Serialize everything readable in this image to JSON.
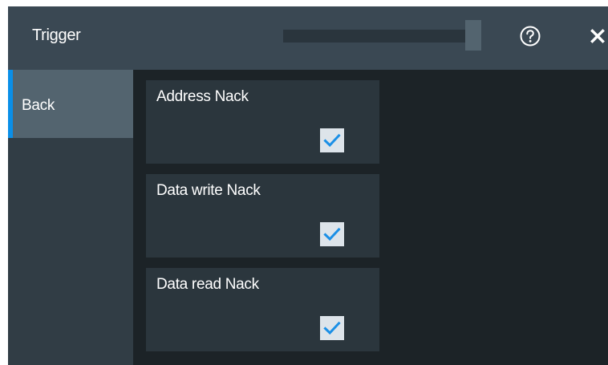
{
  "dialog": {
    "title": "Trigger",
    "help_icon": "help-circle-icon",
    "close_icon": "close-icon"
  },
  "sidebar": {
    "back_label": "Back",
    "accent_color": "#0a8fe8"
  },
  "options": [
    {
      "label": "Address Nack",
      "checked": true
    },
    {
      "label": "Data write Nack",
      "checked": true
    },
    {
      "label": "Data read Nack",
      "checked": true
    }
  ],
  "colors": {
    "background": "#1c2327",
    "header": "#3a4853",
    "card": "#2b363d",
    "check": "#1a8fe6"
  }
}
